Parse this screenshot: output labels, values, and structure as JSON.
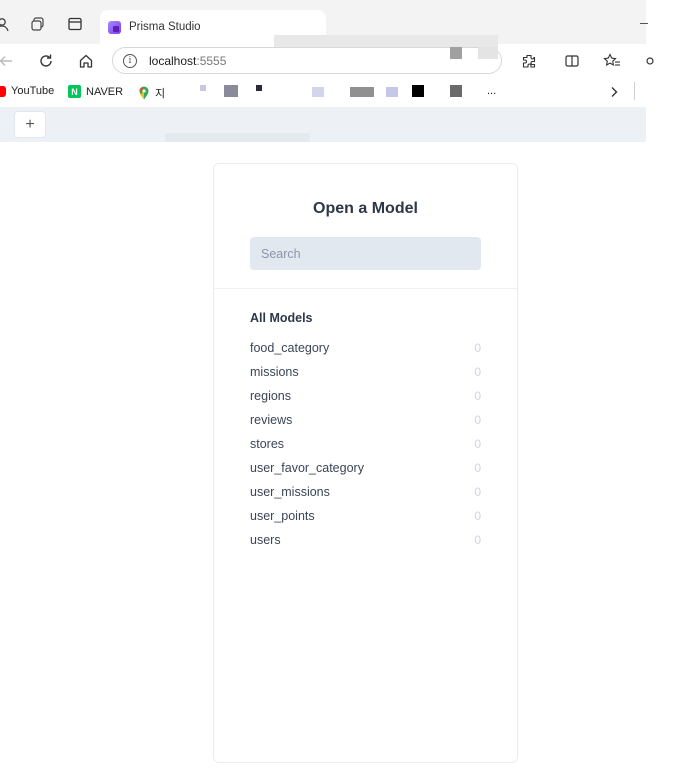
{
  "browser": {
    "tab_title": "Prisma Studio",
    "url_host": "localhost",
    "url_port": ":5555",
    "bookmarks": [
      {
        "label": "YouTube",
        "icon": "youtube-icon"
      },
      {
        "label": "NAVER",
        "icon": "naver-icon"
      },
      {
        "label": "지",
        "icon": "maps-pin-icon"
      }
    ],
    "bookmark_overflow": "..."
  },
  "panel": {
    "title": "Open a Model",
    "search_placeholder": "Search",
    "section_title": "All Models",
    "models": [
      {
        "name": "food_category",
        "count": "0"
      },
      {
        "name": "missions",
        "count": "0"
      },
      {
        "name": "regions",
        "count": "0"
      },
      {
        "name": "reviews",
        "count": "0"
      },
      {
        "name": "stores",
        "count": "0"
      },
      {
        "name": "user_favor_category",
        "count": "0"
      },
      {
        "name": "user_missions",
        "count": "0"
      },
      {
        "name": "user_points",
        "count": "0"
      },
      {
        "name": "users",
        "count": "0"
      }
    ]
  },
  "colors": {
    "accent_prisma": "#7c3aed",
    "search_bg": "#e2e8f0",
    "newtab_bar_bg": "#edf1f6"
  }
}
